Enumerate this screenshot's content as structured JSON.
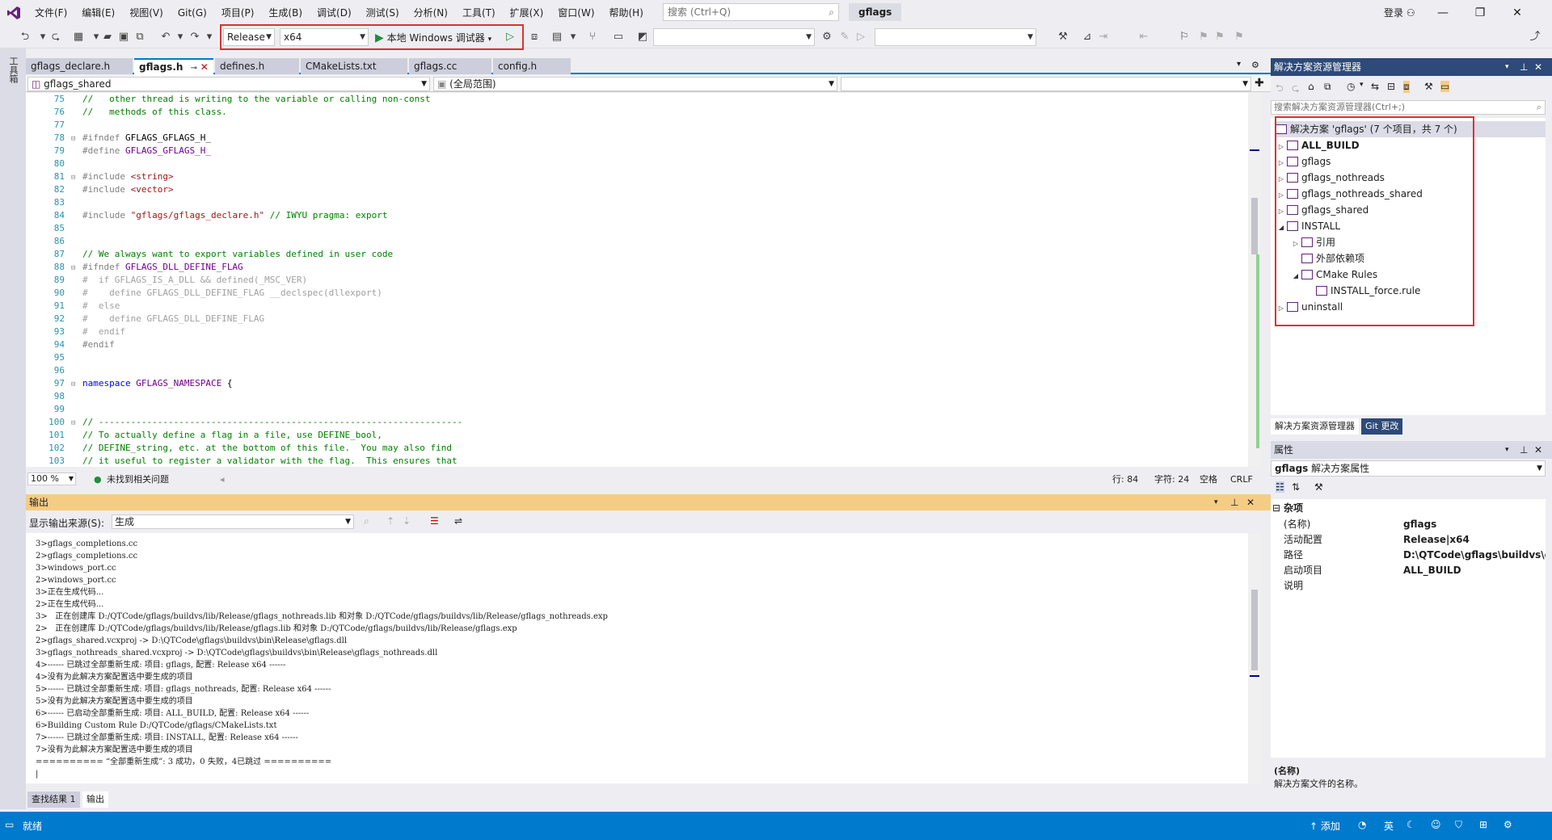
{
  "menubar": {
    "items": [
      "文件(F)",
      "编辑(E)",
      "视图(V)",
      "Git(G)",
      "项目(P)",
      "生成(B)",
      "调试(D)",
      "测试(S)",
      "分析(N)",
      "工具(T)",
      "扩展(X)",
      "窗口(W)",
      "帮助(H)"
    ],
    "search_placeholder": "搜索 (Ctrl+Q)",
    "window_title": "gflags",
    "login": "登录"
  },
  "toolbar": {
    "config": "Release",
    "platform": "x64",
    "debugger": "本地 Windows 调试器"
  },
  "left_strip": {
    "label": "工具箱"
  },
  "editor": {
    "tabs": [
      "gflags_declare.h",
      "gflags.h",
      "defines.h",
      "CMakeLists.txt",
      "gflags.cc",
      "config.h"
    ],
    "active_tab": "gflags.h",
    "nav_project": "gflags_shared",
    "nav_scope": "(全局范围)",
    "lines": [
      {
        "n": "75",
        "fold": "",
        "parts": [
          {
            "c": "cm",
            "t": "//   other thread is writing to the variable or calling non-const"
          }
        ]
      },
      {
        "n": "76",
        "fold": "",
        "parts": [
          {
            "c": "cm",
            "t": "//   methods of this class."
          }
        ]
      },
      {
        "n": "77",
        "fold": "",
        "parts": []
      },
      {
        "n": "78",
        "fold": "⊟",
        "parts": [
          {
            "c": "pp",
            "t": "#ifndef "
          },
          {
            "c": "tx",
            "t": "GFLAGS_GFLAGS_H_"
          }
        ]
      },
      {
        "n": "79",
        "fold": "",
        "parts": [
          {
            "c": "pp",
            "t": "#define "
          },
          {
            "c": "mac",
            "t": "GFLAGS_GFLAGS_H_"
          }
        ]
      },
      {
        "n": "80",
        "fold": "",
        "parts": []
      },
      {
        "n": "81",
        "fold": "⊟",
        "parts": [
          {
            "c": "pp",
            "t": "#include "
          },
          {
            "c": "str",
            "t": "<string>"
          }
        ]
      },
      {
        "n": "82",
        "fold": "",
        "parts": [
          {
            "c": "pp",
            "t": "#include "
          },
          {
            "c": "str",
            "t": "<vector>"
          }
        ]
      },
      {
        "n": "83",
        "fold": "",
        "parts": []
      },
      {
        "n": "84",
        "fold": "",
        "parts": [
          {
            "c": "pp",
            "t": "#include "
          },
          {
            "c": "str",
            "t": "\"gflags/gflags_declare.h\""
          },
          {
            "c": "cm",
            "t": " // IWYU pragma: export"
          }
        ]
      },
      {
        "n": "85",
        "fold": "",
        "parts": []
      },
      {
        "n": "86",
        "fold": "",
        "parts": []
      },
      {
        "n": "87",
        "fold": "",
        "parts": [
          {
            "c": "cm",
            "t": "// We always want to export variables defined in user code"
          }
        ]
      },
      {
        "n": "88",
        "fold": "⊟",
        "parts": [
          {
            "c": "pp",
            "t": "#ifndef "
          },
          {
            "c": "mac",
            "t": "GFLAGS_DLL_DEFINE_FLAG"
          }
        ]
      },
      {
        "n": "89",
        "fold": "",
        "parts": [
          {
            "c": "dim",
            "t": "#  if GFLAGS_IS_A_DLL && defined(_MSC_VER)"
          }
        ]
      },
      {
        "n": "90",
        "fold": "",
        "parts": [
          {
            "c": "dim",
            "t": "#    define GFLAGS_DLL_DEFINE_FLAG __declspec(dllexport)"
          }
        ]
      },
      {
        "n": "91",
        "fold": "",
        "parts": [
          {
            "c": "dim",
            "t": "#  else"
          }
        ]
      },
      {
        "n": "92",
        "fold": "",
        "parts": [
          {
            "c": "dim",
            "t": "#    define GFLAGS_DLL_DEFINE_FLAG"
          }
        ]
      },
      {
        "n": "93",
        "fold": "",
        "parts": [
          {
            "c": "dim",
            "t": "#  endif"
          }
        ]
      },
      {
        "n": "94",
        "fold": "",
        "parts": [
          {
            "c": "pp",
            "t": "#endif"
          }
        ]
      },
      {
        "n": "95",
        "fold": "",
        "parts": []
      },
      {
        "n": "96",
        "fold": "",
        "parts": []
      },
      {
        "n": "97",
        "fold": "⊟",
        "parts": [
          {
            "c": "kw",
            "t": "namespace "
          },
          {
            "c": "mac",
            "t": "GFLAGS_NAMESPACE"
          },
          {
            "c": "tx",
            "t": " {"
          }
        ]
      },
      {
        "n": "98",
        "fold": "",
        "parts": []
      },
      {
        "n": "99",
        "fold": "",
        "parts": []
      },
      {
        "n": "100",
        "fold": "⊟",
        "parts": [
          {
            "c": "cm",
            "t": "// --------------------------------------------------------------------"
          }
        ]
      },
      {
        "n": "101",
        "fold": "",
        "parts": [
          {
            "c": "cm",
            "t": "// To actually define a flag in a file, use DEFINE_bool,"
          }
        ]
      },
      {
        "n": "102",
        "fold": "",
        "parts": [
          {
            "c": "cm",
            "t": "// DEFINE_string, etc. at the bottom of this file.  You may also find"
          }
        ]
      },
      {
        "n": "103",
        "fold": "",
        "parts": [
          {
            "c": "cm",
            "t": "// it useful to register a validator with the flag.  This ensures that"
          }
        ]
      }
    ],
    "zoom": "100 %",
    "issues": "未找到相关问题",
    "line_col": "行: 84",
    "char_col": "字符: 24",
    "whitespace": "空格",
    "eol": "CRLF"
  },
  "output": {
    "title": "输出",
    "source_label": "显示输出来源(S):",
    "source_value": "生成",
    "lines": [
      "3>gflags_completions.cc",
      "2>gflags_completions.cc",
      "3>windows_port.cc",
      "2>windows_port.cc",
      "3>正在生成代码...",
      "2>正在生成代码...",
      "3>   正在创建库 D:/QTCode/gflags/buildvs/lib/Release/gflags_nothreads.lib 和对象 D:/QTCode/gflags/buildvs/lib/Release/gflags_nothreads.exp",
      "2>   正在创建库 D:/QTCode/gflags/buildvs/lib/Release/gflags.lib 和对象 D:/QTCode/gflags/buildvs/lib/Release/gflags.exp",
      "2>gflags_shared.vcxproj -> D:\\QTCode\\gflags\\buildvs\\bin\\Release\\gflags.dll",
      "3>gflags_nothreads_shared.vcxproj -> D:\\QTCode\\gflags\\buildvs\\bin\\Release\\gflags_nothreads.dll",
      "4>------ 已跳过全部重新生成: 项目: gflags, 配置: Release x64 ------",
      "4>没有为此解决方案配置选中要生成的项目",
      "5>------ 已跳过全部重新生成: 项目: gflags_nothreads, 配置: Release x64 ------",
      "5>没有为此解决方案配置选中要生成的项目",
      "6>------ 已启动全部重新生成: 项目: ALL_BUILD, 配置: Release x64 ------",
      "6>Building Custom Rule D:/QTCode/gflags/CMakeLists.txt",
      "7>------ 已跳过全部重新生成: 项目: INSTALL, 配置: Release x64 ------",
      "7>没有为此解决方案配置选中要生成的项目",
      "========== “全部重新生成”: 3 成功，0 失败，4已跳过 =========="
    ],
    "tabs": [
      "查找结果 1",
      "输出"
    ]
  },
  "statusbar": {
    "text": "就绪",
    "add_source": "添加",
    "ime": "英"
  },
  "solution_explorer": {
    "title": "解决方案资源管理器",
    "search_placeholder": "搜索解决方案资源管理器(Ctrl+;)",
    "root": "解决方案 'gflags' (7 个项目，共 7 个)",
    "items": [
      {
        "label": "ALL_BUILD",
        "bold": true,
        "indent": 0,
        "exp": "▷"
      },
      {
        "label": "gflags",
        "bold": false,
        "indent": 0,
        "exp": "▷"
      },
      {
        "label": "gflags_nothreads",
        "bold": false,
        "indent": 0,
        "exp": "▷"
      },
      {
        "label": "gflags_nothreads_shared",
        "bold": false,
        "indent": 0,
        "exp": "▷"
      },
      {
        "label": "gflags_shared",
        "bold": false,
        "indent": 0,
        "exp": "▷"
      },
      {
        "label": "INSTALL",
        "bold": false,
        "indent": 0,
        "exp": "◢"
      },
      {
        "label": "引用",
        "bold": false,
        "indent": 1,
        "exp": "▷"
      },
      {
        "label": "外部依赖项",
        "bold": false,
        "indent": 1,
        "exp": ""
      },
      {
        "label": "CMake Rules",
        "bold": false,
        "indent": 1,
        "exp": "◢"
      },
      {
        "label": "INSTALL_force.rule",
        "bold": false,
        "indent": 2,
        "exp": ""
      },
      {
        "label": "uninstall",
        "bold": false,
        "indent": 0,
        "exp": "▷"
      }
    ],
    "tabs": [
      "解决方案资源管理器",
      "Git 更改"
    ]
  },
  "properties": {
    "title": "属性",
    "selected_object": "gflags",
    "selected_type": "解决方案属性",
    "category": "杂项",
    "rows": [
      {
        "k": "(名称)",
        "v": "gflags"
      },
      {
        "k": "活动配置",
        "v": "Release|x64"
      },
      {
        "k": "路径",
        "v": "D:\\QTCode\\gflags\\buildvs\\g"
      },
      {
        "k": "启动项目",
        "v": "ALL_BUILD"
      },
      {
        "k": "说明",
        "v": ""
      }
    ],
    "desc_title": "(名称)",
    "desc_text": "解决方案文件的名称。"
  }
}
